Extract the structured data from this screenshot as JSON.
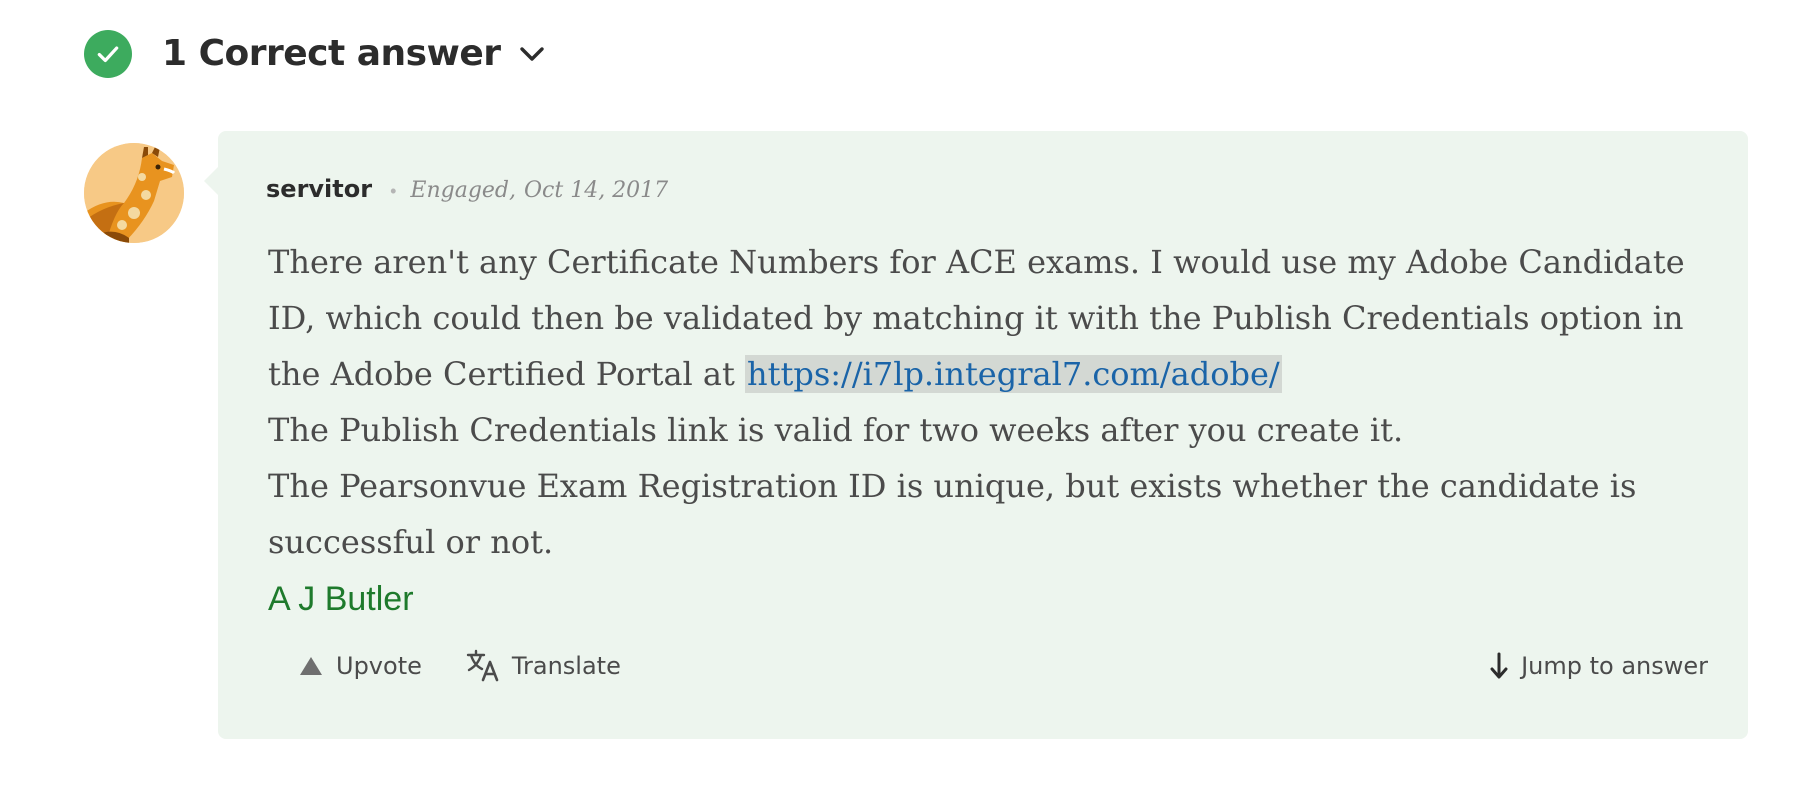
{
  "header": {
    "title": "1 Correct answer",
    "accent_color": "#3dab5e",
    "icon": "check-circle-icon",
    "toggle_icon": "chevron-down-icon"
  },
  "answer": {
    "author": "servitor",
    "separator": "•",
    "rank": "Engaged",
    "date_separator": ",",
    "date": "Oct 14, 2017",
    "avatar_icon": "giraffe-avatar",
    "body": {
      "paragraph1_before_link": "There aren't any Certificate Numbers for ACE exams. I would use my Adobe Candidate ID, which could then be validated by matching it with the Publish Credentials option in the Adobe Certified Portal at ",
      "link_text": "https://i7lp.integral7.com/adobe/",
      "paragraph2": "The Publish Credentials link is valid for two weeks after you create it.",
      "paragraph3": "The Pearsonvue Exam Registration ID is unique, but exists whether the candidate is successful or not."
    },
    "signature": "A J Butler",
    "signature_color": "#1e7a2c",
    "card_background": "#edf5ee",
    "link_color": "#1a64a8"
  },
  "actions": {
    "upvote": {
      "label": "Upvote",
      "icon": "triangle-up-icon"
    },
    "translate": {
      "label": "Translate",
      "icon": "translate-icon"
    },
    "jump": {
      "label": "Jump to answer",
      "icon": "arrow-down-icon"
    }
  }
}
